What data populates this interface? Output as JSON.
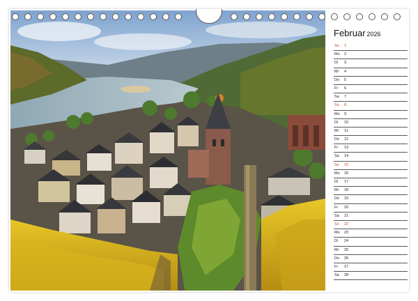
{
  "calendar": {
    "month": "Februar",
    "year": "2026",
    "days": [
      {
        "wd": "So",
        "d": "1",
        "holiday": true
      },
      {
        "wd": "Mo",
        "d": "2",
        "holiday": false
      },
      {
        "wd": "Di",
        "d": "3",
        "holiday": false
      },
      {
        "wd": "Mi",
        "d": "4",
        "holiday": false
      },
      {
        "wd": "Do",
        "d": "5",
        "holiday": false
      },
      {
        "wd": "Fr",
        "d": "6",
        "holiday": false
      },
      {
        "wd": "Sa",
        "d": "7",
        "holiday": false
      },
      {
        "wd": "So",
        "d": "8",
        "holiday": true
      },
      {
        "wd": "Mo",
        "d": "9",
        "holiday": false
      },
      {
        "wd": "Di",
        "d": "10",
        "holiday": false
      },
      {
        "wd": "Mi",
        "d": "11",
        "holiday": false
      },
      {
        "wd": "Do",
        "d": "12",
        "holiday": false
      },
      {
        "wd": "Fr",
        "d": "13",
        "holiday": false
      },
      {
        "wd": "Sa",
        "d": "14",
        "holiday": false
      },
      {
        "wd": "So",
        "d": "15",
        "holiday": true
      },
      {
        "wd": "Mo",
        "d": "16",
        "holiday": false
      },
      {
        "wd": "Di",
        "d": "17",
        "holiday": false
      },
      {
        "wd": "Mi",
        "d": "18",
        "holiday": false
      },
      {
        "wd": "Do",
        "d": "19",
        "holiday": false
      },
      {
        "wd": "Fr",
        "d": "20",
        "holiday": false
      },
      {
        "wd": "Sa",
        "d": "21",
        "holiday": false
      },
      {
        "wd": "So",
        "d": "22",
        "holiday": true
      },
      {
        "wd": "Mo",
        "d": "23",
        "holiday": false
      },
      {
        "wd": "Di",
        "d": "24",
        "holiday": false
      },
      {
        "wd": "Mi",
        "d": "25",
        "holiday": false
      },
      {
        "wd": "Do",
        "d": "26",
        "holiday": false
      },
      {
        "wd": "Fr",
        "d": "27",
        "holiday": false
      },
      {
        "wd": "Sa",
        "d": "28",
        "holiday": false
      }
    ]
  },
  "colors": {
    "holiday_text": "#d43a2a",
    "ring_stroke": "#555555"
  },
  "photo_subject": "rhine-valley-town-vineyard"
}
